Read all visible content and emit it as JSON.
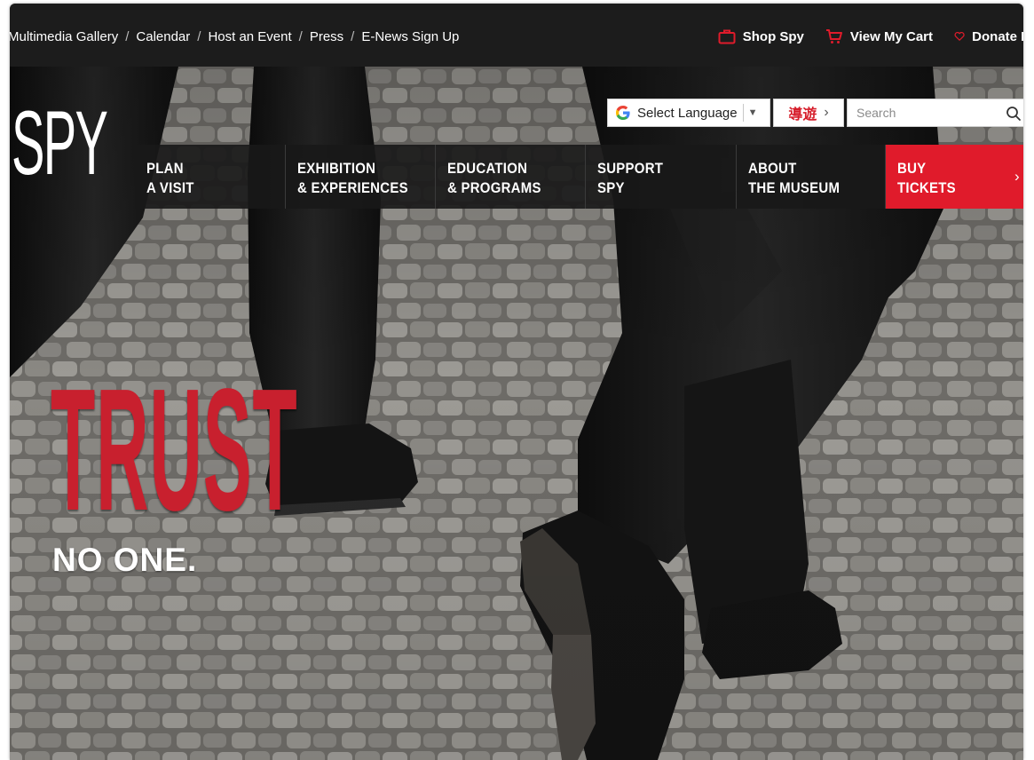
{
  "utility_nav": {
    "links": [
      {
        "label": "Multimedia Gallery"
      },
      {
        "label": "Calendar"
      },
      {
        "label": "Host an Event"
      },
      {
        "label": "Press"
      },
      {
        "label": "E-News Sign Up"
      }
    ],
    "separator": "/",
    "shop_label": "Shop Spy",
    "cart_label": "View My Cart",
    "donate_label": "Donate N"
  },
  "logo": {
    "text": "SPY"
  },
  "language": {
    "label": "Select Language",
    "dropdown_arrow": "▼"
  },
  "guide": {
    "label": "導遊",
    "chevron": "›"
  },
  "search": {
    "placeholder": "Search"
  },
  "main_nav": {
    "items": [
      {
        "line1": "PLAN",
        "line2": "A VISIT"
      },
      {
        "line1": "EXHIBITION",
        "line2": "& EXPERIENCES"
      },
      {
        "line1": "EDUCATION",
        "line2": "& PROGRAMS"
      },
      {
        "line1": "SUPPORT",
        "line2": "SPY"
      },
      {
        "line1": "ABOUT",
        "line2": "THE MUSEUM"
      },
      {
        "line1": "BUY",
        "line2": "TICKETS",
        "chevron": "›"
      }
    ]
  },
  "hero": {
    "headline": "TRUST",
    "subhead": "NO ONE."
  },
  "colors": {
    "brand_red": "#e01b2b",
    "headline_red": "#c8202e",
    "topbar": "#1c1c1c",
    "nav_bg": "#181818"
  },
  "icons": [
    "briefcase-icon",
    "cart-icon",
    "heart-icon",
    "google-icon",
    "search-icon",
    "chevron-right-icon"
  ]
}
